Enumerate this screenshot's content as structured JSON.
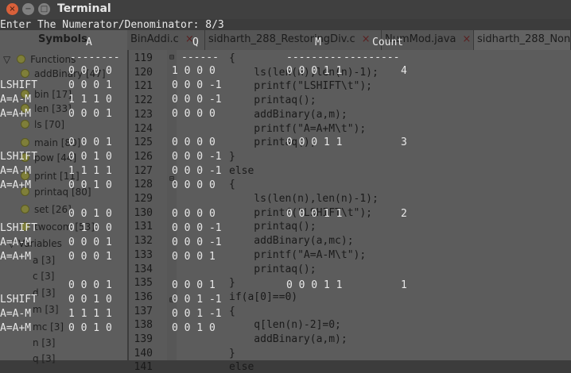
{
  "window": {
    "title": "Terminal",
    "close": "×",
    "min": "−",
    "max": "□"
  },
  "prompt": "Enter The Numerator/Denominator: 8/3",
  "headers": {
    "a": "A",
    "q": "Q",
    "m": "M",
    "count": "Count",
    "dash_a": "--------",
    "dash_q": "------",
    "dash_m": "---------",
    "dash_count": "---------"
  },
  "op_labels": {
    "lshift": "LSHIFT",
    "am": "A=A-M",
    "ap": "A=A+M"
  },
  "cols": {
    "a_values": [
      "0 0 0 0",
      "0 0 0 1",
      "1 1 1 0",
      "0 0 0 1",
      "0 0 0 1",
      "0 0 1 0",
      "1 1 1 1",
      "0 0 1 0",
      "0 0 1 0",
      "0 1 0 0",
      "0 0 0 1",
      "0 0 0 1",
      "0 0 0 1",
      "0 0 1 0",
      "1 1 1 1",
      "0 0 1 0"
    ],
    "q_values": [
      "1 0 0 0",
      "0 0 0 -1",
      "0 0 0 -1",
      "0 0 0 0",
      "0 0 0 0",
      "0 0 0 -1",
      "0 0 0 -1",
      "0 0 0 0",
      "0 0 0 0",
      "0 0 0 -1",
      "0 0 0 -1",
      "0 0 0 1",
      "0 0 0 1",
      "0 0 1 -1",
      "0 0 1 -1",
      "0 0 1 0"
    ],
    "m_values": [
      "0 0 0 1 1",
      "0 0 0 1 1",
      "0 0 0 1 1",
      "0 0 0 1 1"
    ],
    "count_values": [
      "4",
      "3",
      "2",
      "1"
    ]
  },
  "sidebar": {
    "title": "Symbols",
    "functions_label": "Functions",
    "items": [
      "addBinary [47]",
      "bin [17]",
      "len [33]",
      "ls [70]",
      "main [80]",
      "pow [44]",
      "print [11]",
      "printaq [80]",
      "set [26]",
      "twocom [53]",
      "Variables",
      "a [3]",
      "c [3]",
      "d [3]",
      "m [3]",
      "mc [3]",
      "n [3]",
      "q [3]"
    ]
  },
  "tabs": [
    {
      "label": "BinAddi.c",
      "close": "×"
    },
    {
      "label": "sidharth_288_RestoringDiv.c",
      "close": "×"
    },
    {
      "label": "NumMod.java",
      "close": "×"
    },
    {
      "label": "sidharth_288_Non",
      "close": ""
    }
  ],
  "editor": {
    "line_numbers": [
      "119",
      "120",
      "121",
      "122",
      "123",
      "124",
      "125",
      "126",
      "127",
      "128",
      "129",
      "130",
      "131",
      "132",
      "133",
      "134",
      "135",
      "136",
      "137",
      "138",
      "139",
      "140",
      "141"
    ],
    "lines": [
      "{",
      "    ls(len(n),len(n)-1);",
      "    printf(\"LSHIFT\\t\");",
      "    printaq();",
      "    addBinary(a,m);",
      "    printf(\"A=A+M\\t\");",
      "    printaq();",
      "}",
      "else",
      "{",
      "    ls(len(n),len(n)-1);",
      "    printf(\"LSHIFT\\t\");",
      "    printaq();",
      "    addBinary(a,mc);",
      "    printf(\"A=A-M\\t\");",
      "    printaq();",
      "}",
      "if(a[0]==0)",
      "{",
      "    q[len(n)-2]=0;",
      "    addBinary(a,m);",
      "}",
      "else"
    ],
    "fold_marks": [
      "⊟",
      "⊟",
      "⊟"
    ]
  },
  "colors": {
    "terminal_text": "#e8e8e8",
    "close_button": "#d8603a",
    "title_bar": "#404040"
  }
}
